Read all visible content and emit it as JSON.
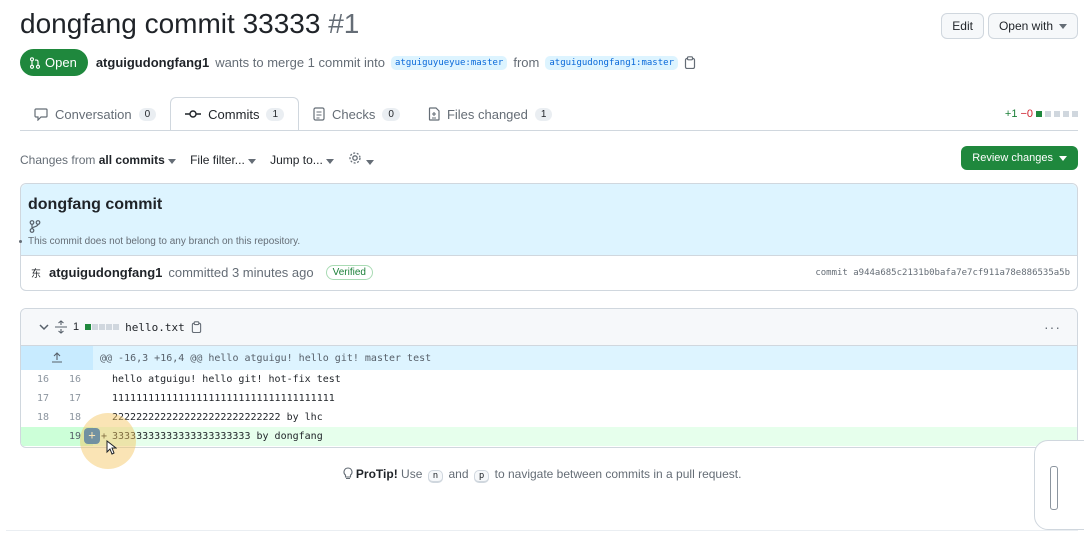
{
  "pr": {
    "title": "dongfang commit 33333",
    "number": "#1",
    "state": "Open",
    "author": "atguigudongfang1",
    "merge_text": "wants to merge 1 commit into",
    "base_branch": "atguiguyueyue:master",
    "from_text": "from",
    "head_branch": "atguigudongfang1:master"
  },
  "header_actions": {
    "edit": "Edit",
    "open_with": "Open with"
  },
  "tabs": [
    {
      "label": "Conversation",
      "count": "0",
      "icon": "comment-icon"
    },
    {
      "label": "Commits",
      "count": "1",
      "icon": "commit-icon"
    },
    {
      "label": "Checks",
      "count": "0",
      "icon": "checklist-icon"
    },
    {
      "label": "Files changed",
      "count": "1",
      "icon": "file-diff-icon"
    }
  ],
  "diffstat": {
    "additions": "+1",
    "deletions": "−0"
  },
  "toolbar": {
    "changes_from": "Changes from",
    "all_commits": "all commits",
    "file_filter": "File filter...",
    "jump_to": "Jump to...",
    "review_changes": "Review changes"
  },
  "commit": {
    "title": "dongfang commit",
    "note": "This commit does not belong to any branch on this repository.",
    "avatar": "东",
    "author": "atguigudongfang1",
    "action": "committed 3 minutes ago",
    "verified": "Verified",
    "sha": "commit a944a685c2131b0bafa7e7cf911a78e886535a5b"
  },
  "file": {
    "changes": "1",
    "name": "hello.txt",
    "more": "···",
    "hunk": "@@ -16,3 +16,4 @@ hello atguigu! hello git! master test",
    "lines": [
      {
        "old": "16",
        "new": "16",
        "text": "hello atguigu! hello git! hot-fix test"
      },
      {
        "old": "17",
        "new": "17",
        "text": "1111111111111111111111111111111111111"
      },
      {
        "old": "18",
        "new": "18",
        "text": "2222222222222222222222222222 by lhc"
      }
    ],
    "added_line": {
      "new": "19",
      "sign": "+",
      "text": "33333333333333333333333 by dongfang"
    }
  },
  "protip": {
    "label": "ProTip!",
    "use": "Use",
    "key_n": "n",
    "and": "and",
    "key_p": "p",
    "rest": "to navigate between commits in a pull request."
  },
  "colors": {
    "green": "#1f883d",
    "blue": "#0969da",
    "hunk_bg": "#ddf4ff",
    "added_bg": "#e6ffec"
  }
}
